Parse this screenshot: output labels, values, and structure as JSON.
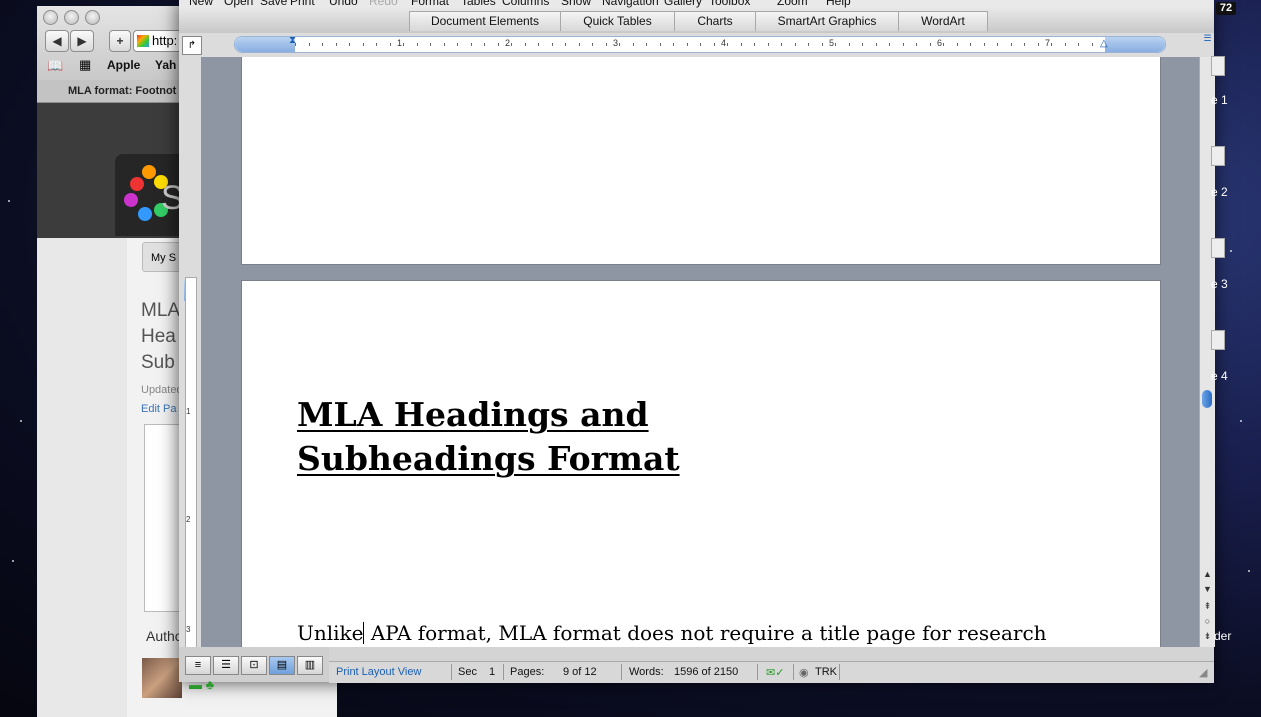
{
  "browser": {
    "address": "http:",
    "bookmarks": [
      "Apple",
      "Yah"
    ],
    "tab_title": "MLA format: Footnot",
    "site_button": "My S",
    "page_title_lines": [
      "MLA",
      "Hea",
      "Sub"
    ],
    "updated": "Updated",
    "edit_page": "Edit Pa",
    "author": "Autho"
  },
  "word": {
    "menu": [
      "New",
      "Open",
      "Save",
      "Print",
      "Undo",
      "Redo",
      "Format",
      "Tables",
      "Columns",
      "Show",
      "Navigation",
      "Gallery",
      "Toolbox",
      "Zoom",
      "Help"
    ],
    "ribbon_tabs": [
      "Document Elements",
      "Quick Tables",
      "Charts",
      "SmartArt Graphics",
      "WordArt"
    ],
    "ruler_numbers": [
      "1",
      "2",
      "3",
      "4",
      "5",
      "6",
      "7"
    ],
    "vruler_numbers": [
      "1",
      "2",
      "3"
    ],
    "document": {
      "heading_line1": "MLA Headings and",
      "heading_line2": "Subheadings Format",
      "body_before_cursor": "Unlike",
      "body_after_cursor": " APA format, MLA format does not require a title page for research"
    },
    "status": {
      "view": "Print Layout View",
      "sec_label": "Sec",
      "sec_value": "1",
      "pages_label": "Pages:",
      "pages_value": "9 of 12",
      "words_label": "Words:",
      "words_value": "1596 of 2150",
      "trk": "TRK"
    }
  },
  "desktop": {
    "badge": "72",
    "labels": [
      "e 1",
      "e 2",
      "e 3",
      "e 4",
      "der"
    ]
  },
  "colors": {
    "accent": "#3a74b8",
    "scroll_thumb": "#2a6cc4"
  }
}
